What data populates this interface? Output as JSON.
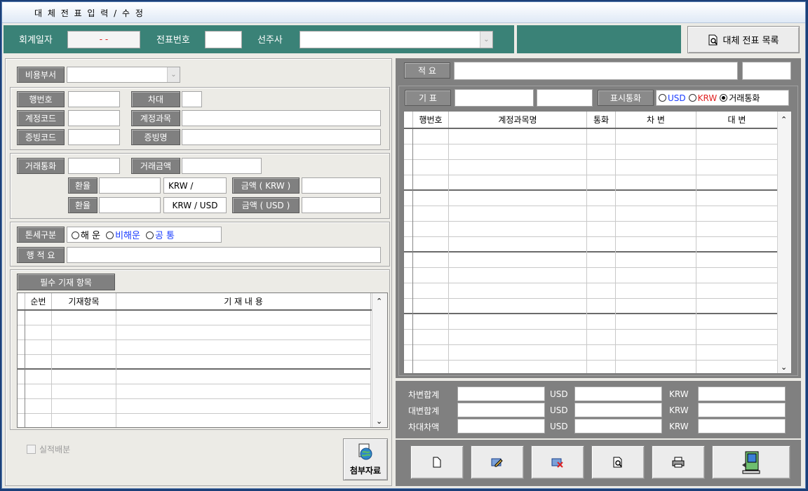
{
  "window": {
    "title": "대 체 전 표 입 력 / 수 정"
  },
  "header": {
    "date_label": "회계일자",
    "date_value": "- -",
    "voucher_label": "전표번호",
    "voucher_value": "",
    "shipowner_label": "선주사",
    "shipowner_value": "",
    "list_button_label": "대체 전표 목록"
  },
  "left": {
    "cost_dept_label": "비용부서",
    "row_no_label": "행번호",
    "debit_credit_label": "차대",
    "account_code_label": "계정코드",
    "account_subject_label": "계정과목",
    "evidence_code_label": "증빙코드",
    "evidence_name_label": "증빙명",
    "txn_currency_label": "거래통화",
    "txn_amount_label": "거래금액",
    "rate_label": "환율",
    "krw_slash": "KRW /",
    "amount_krw_label": "금액 ( KRW )",
    "krw_usd": "KRW / USD",
    "amount_usd_label": "금액 ( USD )",
    "tonnage_label": "톤세구분",
    "tonnage_options": [
      "해 운",
      "비해운",
      "공 통"
    ],
    "tonnage_colors": [
      "#000000",
      "#1a3cff",
      "#1a3cff"
    ],
    "line_memo_label": "행 적 요",
    "required_items_label": "필수 기재 항목",
    "grid_headers": [
      "순번",
      "기재항목",
      "기 재 내 용"
    ],
    "actual_alloc_label": "실적배분",
    "attachment_label": "첨부자료"
  },
  "right": {
    "memo_label": "적 요",
    "memo_value": "",
    "memo_extra": "",
    "base_label": "기 표",
    "display_currency_label": "표시통화",
    "currency_options": [
      "USD",
      "KRW",
      "거래통화"
    ],
    "currency_colors": [
      "#1a3cff",
      "#e02020",
      "#000000"
    ],
    "currency_selected": "거래통화",
    "grid_headers": [
      "행번호",
      "계정과목명",
      "통화",
      "차 변",
      "대 변"
    ],
    "totals": [
      {
        "label": "차변합계",
        "usd": "USD",
        "krw": "KRW"
      },
      {
        "label": "대변합계",
        "usd": "USD",
        "krw": "KRW"
      },
      {
        "label": "차대차액",
        "usd": "USD",
        "krw": "KRW"
      }
    ],
    "toolbar_icons": [
      "new-icon",
      "edit-icon",
      "delete-icon",
      "preview-icon",
      "print-icon",
      "exit-icon"
    ]
  }
}
